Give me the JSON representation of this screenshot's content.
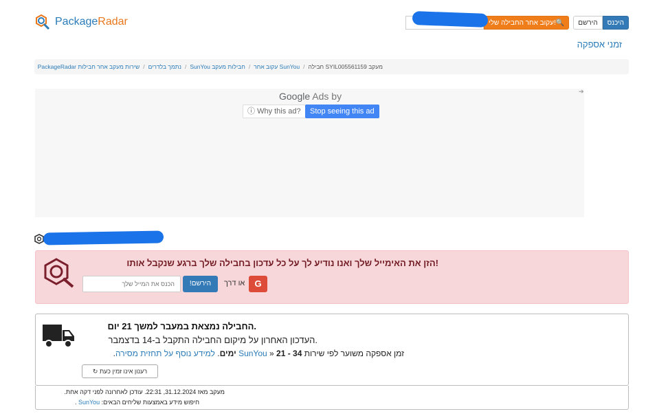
{
  "header": {
    "logo_text": "Package",
    "logo_text_accent": "Radar",
    "register_label": "הירשם",
    "login_label": "היכנס",
    "track_label": "!עקוב אחר החבילה שלי",
    "delivery_link": "זמני אספקה"
  },
  "breadcrumb": {
    "items": [
      "שירות מעקב אחר חבילות PackageRadar",
      "נתמך בלדרים",
      "חבילות מעקב SunYou",
      "SunYou עקוב אחר",
      "מעקב SYIL005561159 חבילה"
    ]
  },
  "ad": {
    "google": "Google",
    "ads_by": "Ads by",
    "why_label": "Why this ad?",
    "stop_label": "Stop seeing this ad"
  },
  "alert": {
    "title": "!הזן את האימייל שלך ואנו נודיע לך על כל עדכון בחבילה שלך ברגע שנקבל אותו",
    "google_label": "G",
    "or_label": "או דרך",
    "signup_label": "!הירשם",
    "email_placeholder": "הכנס את המייל שלך"
  },
  "status": {
    "line1": ".החבילה נמצאת במעבר למשך 21 יום",
    "line2": ".העדכון האחרון על מיקום החבילה התקבל ב-14 בדצמבר",
    "line3_prefix": "זמן אספקה משוער לפי שירות",
    "line3_carrier": "SunYou",
    "line3_range": "21 - 34",
    "line3_days": "ימים",
    "line3_link": "למידע נוסף על תחזית מסירה",
    "refresh_label": "רענון אינו זמין כעת"
  },
  "footer": {
    "line1": "מעקב מאז 31.12.2024, 22:31. עודכן לאחרונה לפני דקה אחת.",
    "line2_prefix": "חיפוש מידע באמצעות שליחים הבאים:",
    "line2_carrier": "SunYou"
  }
}
